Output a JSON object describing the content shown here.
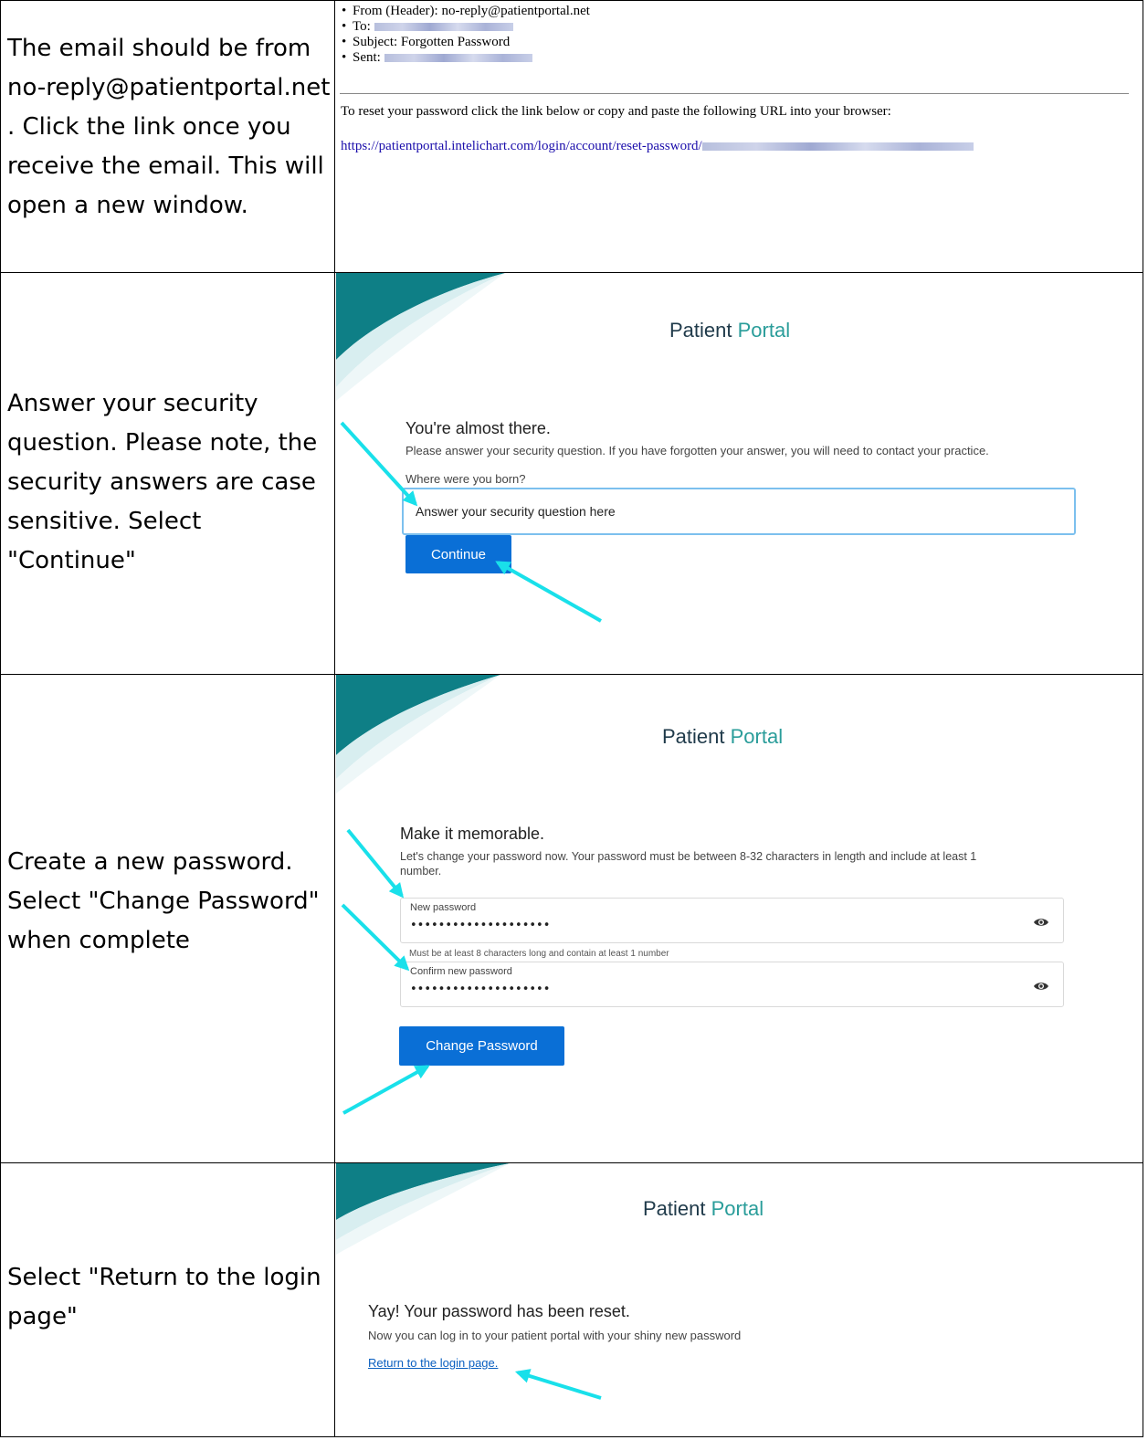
{
  "steps": [
    {
      "text": "The email should be from no-reply@patientportal.net . Click the link once you receive the email. This will open a new window."
    },
    {
      "text": "Answer your security question. Please note, the security answers are case sensitive. Select \"Continue\""
    },
    {
      "text": "Create a new password. Select \"Change Password\" when complete"
    },
    {
      "text": "Select \"Return to the login page\""
    }
  ],
  "email": {
    "from": "From (Header): no-reply@patientportal.net",
    "to_label": "To:",
    "subject": "Subject: Forgotten Password",
    "sent_label": "Sent:",
    "body": "To reset your password click the link below or copy and paste the following URL into your browser:",
    "url": "https://patientportal.intelichart.com/login/account/reset-password/"
  },
  "portal": {
    "title_main": "Patient",
    "title_accent": "Portal"
  },
  "security": {
    "heading": "You're almost there.",
    "instructions": "Please answer your security question. If you have forgotten your answer, you will need to contact your practice.",
    "question": "Where were you born?",
    "input_placeholder": "Answer your security question here",
    "continue_label": "Continue"
  },
  "password": {
    "heading": "Make it memorable.",
    "instructions_line1": "Let's change your password now. Your password must be between 8-32 characters in length and include at least 1",
    "instructions_line2": "number.",
    "new_label": "New password",
    "new_value": "••••••••••••••••••••",
    "hint": "Must be at least 8 characters long and contain at least 1 number",
    "confirm_label": "Confirm new password",
    "confirm_value": "••••••••••••••••••••",
    "change_label": "Change Password"
  },
  "done": {
    "heading": "Yay! Your password has been reset.",
    "message": "Now you can log in to your patient portal with your shiny new password",
    "return_link": "Return to the login page."
  },
  "colors": {
    "accent_teal": "#2a9d9a",
    "button_blue": "#0a6fd6",
    "arrow_cyan": "#19e0ea"
  }
}
